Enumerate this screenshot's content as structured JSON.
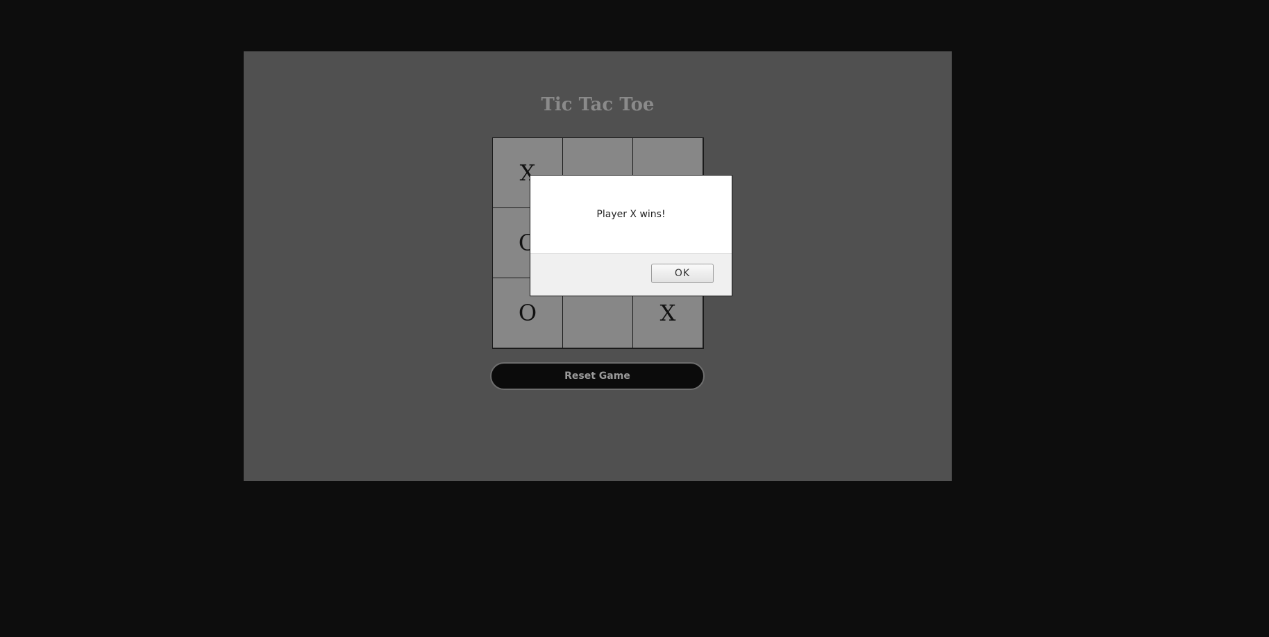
{
  "game": {
    "title": "Tic Tac Toe",
    "board": [
      [
        "X",
        "",
        ""
      ],
      [
        "O",
        "",
        ""
      ],
      [
        "O",
        "",
        "X"
      ]
    ],
    "reset_label": "Reset Game"
  },
  "dialog": {
    "message": "Player X wins!",
    "ok_label": "OK"
  },
  "colors": {
    "background": "#0d0d0d",
    "panel": "#505050",
    "cell": "#878787",
    "title": "#8a8a8a"
  }
}
